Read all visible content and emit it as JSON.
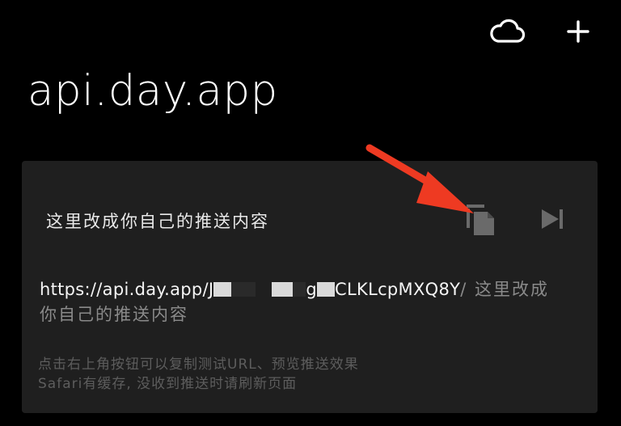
{
  "header": {
    "cloud_icon": "cloud-icon",
    "add_icon": "plus-icon"
  },
  "page_title": "api.day.app",
  "card": {
    "message": "这里改成你自己的推送内容",
    "copy_icon": "copy-icon",
    "next_icon": "play-next-icon",
    "url_prefix": "https://api.day.app/",
    "url_visible_fragment_1": "J",
    "url_visible_fragment_2": "g",
    "url_visible_fragment_3": "CLKLcpMXQ8Y",
    "url_suffix_line1": "/ 这里改成",
    "url_suffix_line2": "你自己的推送内容",
    "hint_line1": "点击右上角按钮可以复制测试URL、预览推送效果",
    "hint_line2": "Safari有缓存, 没收到推送时请刷新页面"
  },
  "annotation": {
    "arrow_color": "#ee3a22"
  },
  "colors": {
    "background": "#000000",
    "card": "#1f1f1f",
    "text_primary": "#ffffff",
    "text_secondary": "#8a8a8a",
    "hint": "#5d5d5d"
  }
}
